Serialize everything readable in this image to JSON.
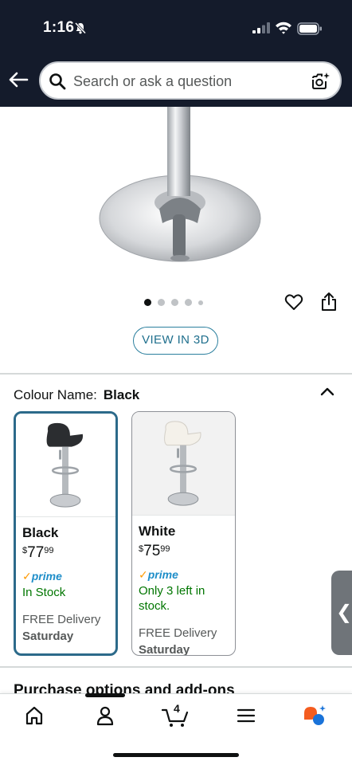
{
  "status_bar": {
    "time": "1:16"
  },
  "search": {
    "placeholder": "Search or ask a question"
  },
  "product": {
    "image_dots": 5,
    "active_dot": 0,
    "view_3d_label": "VIEW IN 3D"
  },
  "colour": {
    "label": "Colour Name:",
    "selected": "Black",
    "options": [
      {
        "name": "Black",
        "price_symbol": "$",
        "price_whole": "77",
        "price_fraction": "99",
        "prime_label": "prime",
        "stock": "In Stock",
        "delivery": "FREE Delivery",
        "delivery_day": "Saturday"
      },
      {
        "name": "White",
        "price_symbol": "$",
        "price_whole": "75",
        "price_fraction": "99",
        "prime_label": "prime",
        "stock": "Only 3 left in stock.",
        "delivery": "FREE Delivery",
        "delivery_day": "Saturday"
      }
    ]
  },
  "sections": {
    "purchase_options": "Purchase options and add-ons"
  },
  "bottom_nav": {
    "cart_count": "4"
  },
  "colors": {
    "header_bg": "#141b2b",
    "selected_border": "#2c6a8a",
    "stock_green": "#007600",
    "prime_blue": "#1f8ec9",
    "prime_check": "#ff9900"
  }
}
